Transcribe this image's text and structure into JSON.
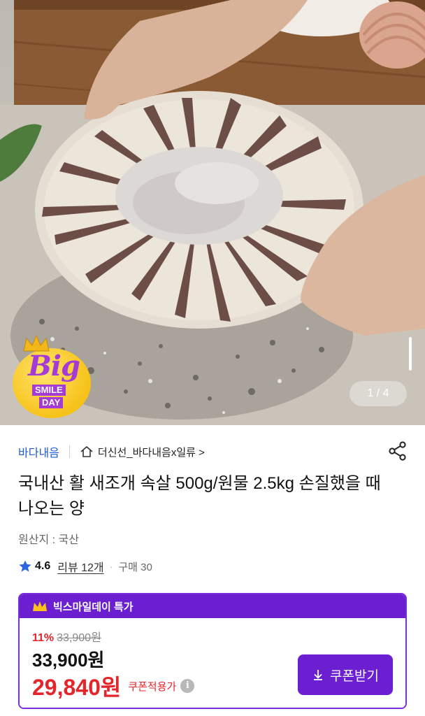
{
  "hero": {
    "pager": "1 / 4",
    "badge": {
      "big": "Big",
      "smile": "SMILE",
      "day": "DAY"
    }
  },
  "shop": {
    "name": "바다내음",
    "store_link": "더신선_바다내음x일류 >"
  },
  "product": {
    "title": "국내산 활 새조개 속살 500g/원물 2.5kg 손질했을 때 나오는 양",
    "origin": "원산지 : 국산",
    "rating": "4.6",
    "reviews": "리뷰 12개",
    "purchases": "구매 30"
  },
  "deal": {
    "label": "빅스마일데이 특가",
    "discount_percent": "11%",
    "original_price": "33,900원",
    "price": "33,900원",
    "sale_price": "29,840원",
    "coupon_applied": "쿠폰적용가",
    "coupon_button": "쿠폰받기"
  },
  "colors": {
    "brand_purple": "#6b1fd1",
    "sale_red": "#e4252b",
    "shop_blue": "#1f5bd6",
    "badge_yellow": "#f6c21a"
  },
  "icons": [
    "home-icon",
    "share-icon",
    "star-icon",
    "crown-icon",
    "info-icon",
    "download-icon"
  ]
}
